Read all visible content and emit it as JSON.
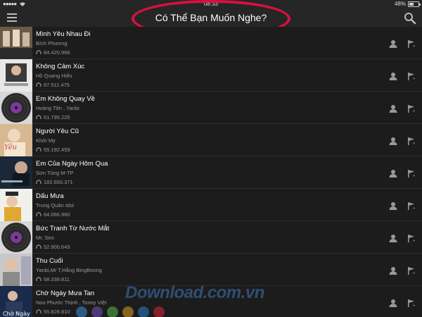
{
  "status_bar": {
    "time": "08:33",
    "battery": "48%",
    "battery_level": 0.48
  },
  "nav": {
    "title": "Có Thể Bạn Muốn Nghe?"
  },
  "icons": {
    "menu": "hamburger-menu-icon",
    "search": "search-icon",
    "plays": "headphones-icon",
    "user": "person-icon",
    "flag": "flag-icon",
    "wifi": "wifi-icon"
  },
  "colors": {
    "highlight": "#d8113f",
    "background": "#1c1c1c",
    "secondary_text": "#9a9a9a"
  },
  "songs": [
    {
      "title": "Mình Yêu Nhau Đi",
      "artist": "Bích Phương",
      "plays": "84.420.966"
    },
    {
      "title": "Không Cảm Xúc",
      "artist": "Hồ Quang Hiếu",
      "plays": "67.511.475"
    },
    {
      "title": "Em Không Quay Về",
      "artist": "Hoàng Tôn , Yanbi",
      "plays": "61.795.225"
    },
    {
      "title": "Người Yêu Cũ",
      "artist": "Khởi My",
      "plays": "55.192.459"
    },
    {
      "title": "Em Của Ngày Hôm Qua",
      "artist": "Sơn Tùng M-TP",
      "plays": "182.650.371"
    },
    {
      "title": "Dấu Mưa",
      "artist": "Trung Quân Idol",
      "plays": "64.066.960"
    },
    {
      "title": "Bức Tranh Từ Nước Mắt",
      "artist": "Mr. Siro",
      "plays": "52.900.643"
    },
    {
      "title": "Thu Cuối",
      "artist": "Yanbi,Mr T,Hằng BingBoong",
      "plays": "58.339.811"
    },
    {
      "title": "Chờ Ngày Mưa Tan",
      "artist": "Noo Phước Thịnh , Tonny Việt",
      "plays": "55.828.810"
    }
  ],
  "watermark": "Download.com.vn"
}
